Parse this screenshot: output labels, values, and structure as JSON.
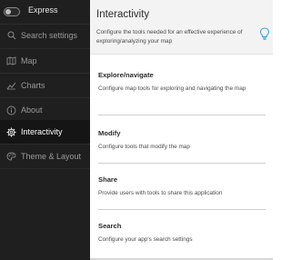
{
  "sidebar": {
    "toggle_label": "Express",
    "items": [
      {
        "label": "Search settings",
        "icon": "search-icon"
      },
      {
        "label": "Map",
        "icon": "map-icon"
      },
      {
        "label": "Charts",
        "icon": "chart-icon"
      },
      {
        "label": "About",
        "icon": "info-icon"
      },
      {
        "label": "Interactivity",
        "icon": "gear-icon"
      },
      {
        "label": "Theme & Layout",
        "icon": "palette-icon"
      }
    ],
    "active": "Interactivity"
  },
  "main": {
    "title": "Interactivity",
    "description": "Configure the tools needed for an effective experience of exploring/analyzing your map",
    "sections": [
      {
        "title": "Explore/navigate",
        "description": "Configure map tools for exploring and navigating the map"
      },
      {
        "title": "Modify",
        "description": "Configure tools that modify the map"
      },
      {
        "title": "Share",
        "description": "Provide users with tools to share this application"
      },
      {
        "title": "Search",
        "description": "Configure your app's search settings"
      }
    ]
  },
  "colors": {
    "sidebar_bg": "#1f1f1f",
    "active_bg": "#151515",
    "header_bg": "#f3f3f3",
    "accent": "#39a0d8"
  }
}
